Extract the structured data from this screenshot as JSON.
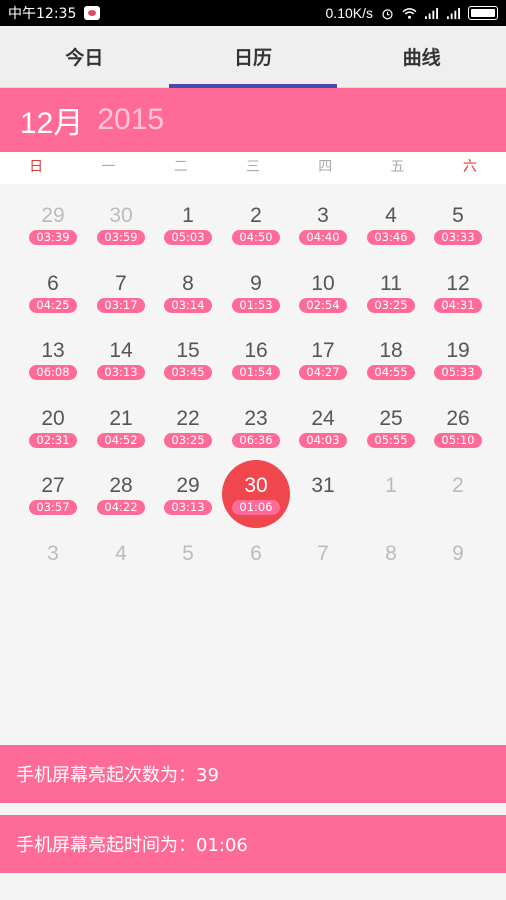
{
  "status": {
    "time": "中午12:35",
    "speed": "0.10K/s"
  },
  "tabs": [
    {
      "label": "今日"
    },
    {
      "label": "日历"
    },
    {
      "label": "曲线"
    }
  ],
  "header": {
    "month": "12月",
    "year": "2015"
  },
  "weekdays": [
    "日",
    "一",
    "二",
    "三",
    "四",
    "五",
    "六"
  ],
  "calendar": {
    "weeks": [
      [
        {
          "day": "29",
          "time": "03:39",
          "other": true
        },
        {
          "day": "30",
          "time": "03:59",
          "other": true
        },
        {
          "day": "1",
          "time": "05:03"
        },
        {
          "day": "2",
          "time": "04:50"
        },
        {
          "day": "3",
          "time": "04:40"
        },
        {
          "day": "4",
          "time": "03:46"
        },
        {
          "day": "5",
          "time": "03:33"
        }
      ],
      [
        {
          "day": "6",
          "time": "04:25"
        },
        {
          "day": "7",
          "time": "03:17"
        },
        {
          "day": "8",
          "time": "03:14"
        },
        {
          "day": "9",
          "time": "01:53"
        },
        {
          "day": "10",
          "time": "02:54"
        },
        {
          "day": "11",
          "time": "03:25"
        },
        {
          "day": "12",
          "time": "04:31"
        }
      ],
      [
        {
          "day": "13",
          "time": "06:08"
        },
        {
          "day": "14",
          "time": "03:13"
        },
        {
          "day": "15",
          "time": "03:45"
        },
        {
          "day": "16",
          "time": "01:54"
        },
        {
          "day": "17",
          "time": "04:27"
        },
        {
          "day": "18",
          "time": "04:55"
        },
        {
          "day": "19",
          "time": "05:33"
        }
      ],
      [
        {
          "day": "20",
          "time": "02:31"
        },
        {
          "day": "21",
          "time": "04:52"
        },
        {
          "day": "22",
          "time": "03:25"
        },
        {
          "day": "23",
          "time": "06:36"
        },
        {
          "day": "24",
          "time": "04:03"
        },
        {
          "day": "25",
          "time": "05:55"
        },
        {
          "day": "26",
          "time": "05:10"
        }
      ],
      [
        {
          "day": "27",
          "time": "03:57"
        },
        {
          "day": "28",
          "time": "04:22"
        },
        {
          "day": "29",
          "time": "03:13"
        },
        {
          "day": "30",
          "time": "01:06",
          "selected": true
        },
        {
          "day": "31"
        },
        {
          "day": "1",
          "other": true
        },
        {
          "day": "2",
          "other": true
        }
      ],
      [
        {
          "day": "3",
          "other": true
        },
        {
          "day": "4",
          "other": true
        },
        {
          "day": "5",
          "other": true
        },
        {
          "day": "6",
          "other": true
        },
        {
          "day": "7",
          "other": true
        },
        {
          "day": "8",
          "other": true
        },
        {
          "day": "9",
          "other": true
        }
      ]
    ]
  },
  "stats": {
    "count_text": "手机屏幕亮起次数为：39",
    "duration_text": "手机屏幕亮起时间为：01:06"
  },
  "colors": {
    "accent": "#ff6b98",
    "selected": "#f0464e",
    "tab_indicator": "#4a4aa8",
    "weekend": "#e03a3a"
  }
}
